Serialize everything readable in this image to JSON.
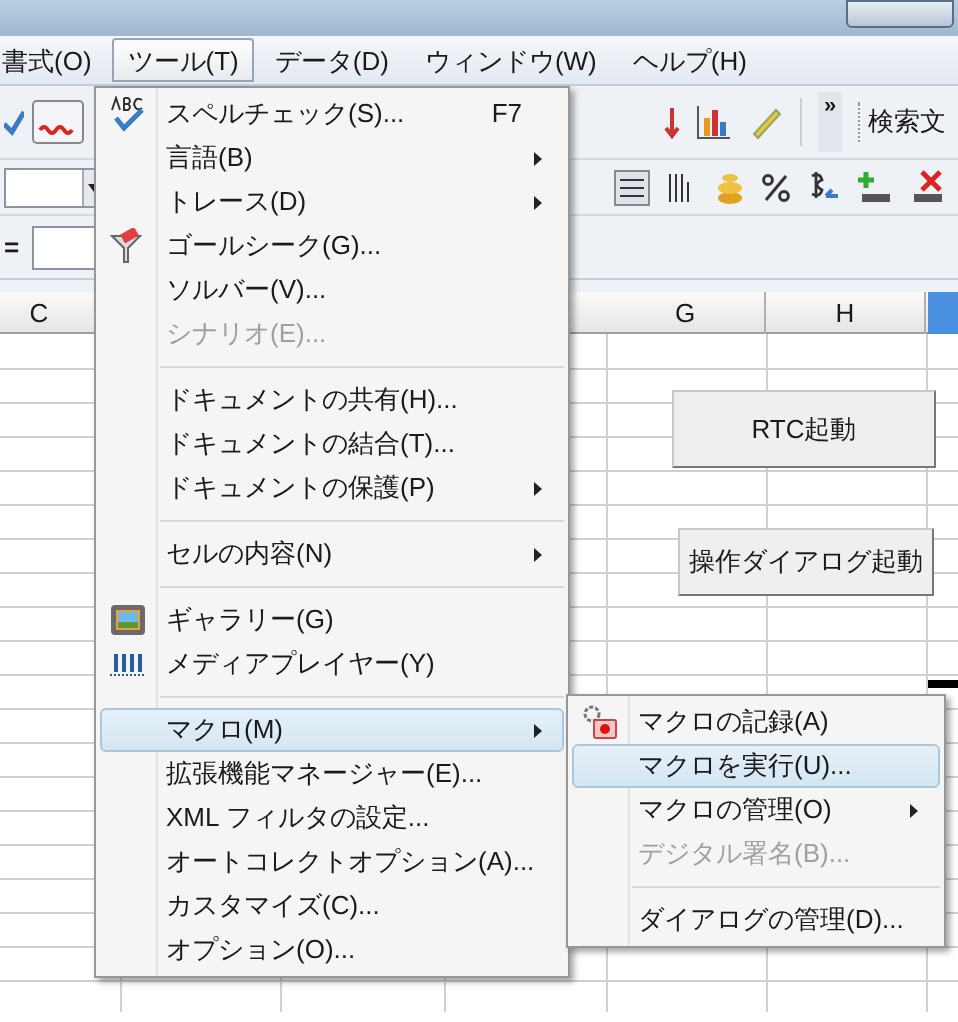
{
  "menubar": [
    {
      "label": "書式(O)",
      "selected": false
    },
    {
      "label": "ツール(T)",
      "selected": true
    },
    {
      "label": "データ(D)",
      "selected": false
    },
    {
      "label": "ウィンドウ(W)",
      "selected": false
    },
    {
      "label": "ヘルプ(H)",
      "selected": false
    }
  ],
  "toolbar": {
    "search_field": "検索文",
    "overflow": "»"
  },
  "formula_bar": {
    "label": "="
  },
  "columns": [
    {
      "label": "C",
      "selected": false
    },
    {
      "label": "G",
      "selected": false
    },
    {
      "label": "H",
      "selected": false
    }
  ],
  "sheet_buttons": [
    "RTC起動",
    "操作ダイアログ起動"
  ],
  "tools_menu": [
    {
      "kind": "item",
      "label": "スペルチェック(S)...",
      "shortcut": "F7",
      "submenu": false,
      "disabled": false,
      "selected": false
    },
    {
      "kind": "item",
      "label": "言語(B)",
      "submenu": true,
      "disabled": false,
      "selected": false
    },
    {
      "kind": "item",
      "label": "トレース(D)",
      "submenu": true,
      "disabled": false,
      "selected": false
    },
    {
      "kind": "item",
      "label": "ゴールシーク(G)...",
      "submenu": false,
      "disabled": false,
      "selected": false
    },
    {
      "kind": "item",
      "label": "ソルバー(V)...",
      "submenu": false,
      "disabled": false,
      "selected": false
    },
    {
      "kind": "item",
      "label": "シナリオ(E)...",
      "submenu": false,
      "disabled": true,
      "selected": false
    },
    {
      "kind": "separator"
    },
    {
      "kind": "item",
      "label": "ドキュメントの共有(H)...",
      "submenu": false,
      "disabled": false,
      "selected": false
    },
    {
      "kind": "item",
      "label": "ドキュメントの結合(T)...",
      "submenu": false,
      "disabled": false,
      "selected": false
    },
    {
      "kind": "item",
      "label": "ドキュメントの保護(P)",
      "submenu": true,
      "disabled": false,
      "selected": false
    },
    {
      "kind": "separator"
    },
    {
      "kind": "item",
      "label": "セルの内容(N)",
      "submenu": true,
      "disabled": false,
      "selected": false
    },
    {
      "kind": "separator"
    },
    {
      "kind": "item",
      "label": "ギャラリー(G)",
      "submenu": false,
      "disabled": false,
      "selected": false
    },
    {
      "kind": "item",
      "label": "メディアプレイヤー(Y)",
      "submenu": false,
      "disabled": false,
      "selected": false
    },
    {
      "kind": "separator"
    },
    {
      "kind": "item",
      "label": "マクロ(M)",
      "submenu": true,
      "disabled": false,
      "selected": true
    },
    {
      "kind": "item",
      "label": "拡張機能マネージャー(E)...",
      "submenu": false,
      "disabled": false,
      "selected": false
    },
    {
      "kind": "item",
      "label": "XML フィルタの設定...",
      "submenu": false,
      "disabled": false,
      "selected": false
    },
    {
      "kind": "item",
      "label": "オートコレクトオプション(A)...",
      "submenu": false,
      "disabled": false,
      "selected": false
    },
    {
      "kind": "item",
      "label": "カスタマイズ(C)...",
      "submenu": false,
      "disabled": false,
      "selected": false
    },
    {
      "kind": "item",
      "label": "オプション(O)...",
      "submenu": false,
      "disabled": false,
      "selected": false
    }
  ],
  "macro_submenu": [
    {
      "kind": "item",
      "label": "マクロの記録(A)",
      "submenu": false,
      "disabled": false,
      "selected": false
    },
    {
      "kind": "item",
      "label": "マクロを実行(U)...",
      "submenu": false,
      "disabled": false,
      "selected": true
    },
    {
      "kind": "item",
      "label": "マクロの管理(O)",
      "submenu": true,
      "disabled": false,
      "selected": false
    },
    {
      "kind": "item",
      "label": "デジタル署名(B)...",
      "submenu": false,
      "disabled": true,
      "selected": false
    },
    {
      "kind": "separator"
    },
    {
      "kind": "item",
      "label": "ダイアログの管理(D)...",
      "submenu": false,
      "disabled": false,
      "selected": false
    }
  ]
}
